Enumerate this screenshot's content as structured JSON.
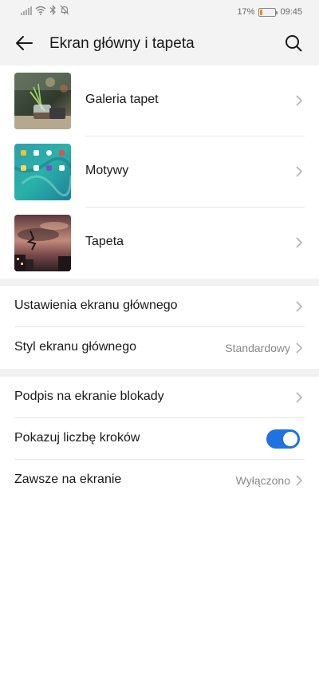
{
  "status_bar": {
    "battery_percent": "17%",
    "time": "09:45",
    "battery_level": 0.17,
    "icons": [
      "signal-icon",
      "wifi-icon",
      "bluetooth-icon",
      "bell-off-icon",
      "battery-icon"
    ]
  },
  "header": {
    "title": "Ekran główny i tapeta",
    "back_icon": "arrow-left-icon",
    "search_icon": "search-icon"
  },
  "theme_items": [
    {
      "label": "Galeria tapet",
      "thumbnail": "plant-jar-photo"
    },
    {
      "label": "Motywy",
      "thumbnail": "homescreen-theme-preview"
    },
    {
      "label": "Tapeta",
      "thumbnail": "sunset-sky-photo"
    }
  ],
  "home_settings": [
    {
      "label": "Ustawienia ekranu głównego",
      "value": ""
    },
    {
      "label": "Styl ekranu głównego",
      "value": "Standardowy"
    }
  ],
  "lock_settings": [
    {
      "label": "Podpis na ekranie blokady",
      "value": ""
    },
    {
      "label": "Pokazuj liczbę kroków",
      "toggle_on": true
    },
    {
      "label": "Zawsze na ekranie",
      "value": "Wyłączono"
    }
  ],
  "colors": {
    "accent": "#1f72e0",
    "background": "#ffffff",
    "section_gap": "#f1f1f1",
    "secondary_text": "#8a8a8a"
  }
}
